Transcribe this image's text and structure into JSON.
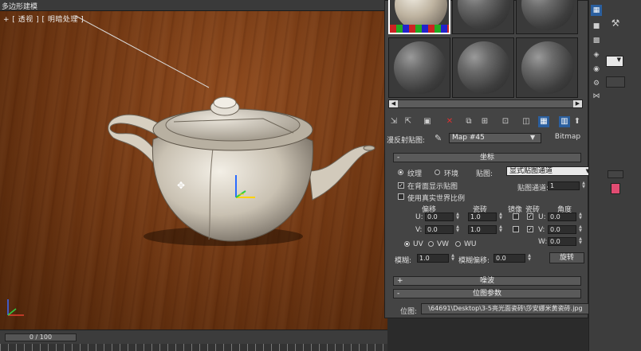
{
  "viewport": {
    "title": "多边形建模",
    "label": "+ [ 透视 ] [ 明暗处理 ]"
  },
  "timeline": {
    "frame": "0 / 100"
  },
  "material_editor": {
    "map_label": "漫反射贴图:",
    "map_name": "Map #45",
    "map_type": "Bitmap",
    "coords": {
      "header": "坐标",
      "texture": "纹理",
      "environ": "环境",
      "mapping_label": "贴图:",
      "mapping_value": "显式贴图通道",
      "show_on_back": "在背面显示贴图",
      "real_world": "使用真实世界比例",
      "map_channel_label": "贴图通道:",
      "map_channel_value": "1",
      "offset": "偏移",
      "tiling": "瓷砖",
      "mirror": "镜像",
      "tile": "瓷砖",
      "angle": "角度",
      "u": "U:",
      "v": "V:",
      "w": "W:",
      "u_offset": "0.0",
      "v_offset": "0.0",
      "u_tiling": "1.0",
      "v_tiling": "1.0",
      "u_angle": "0.0",
      "v_angle": "0.0",
      "w_angle": "0.0",
      "uv": "UV",
      "vw": "VW",
      "wu": "WU",
      "blur_label": "模糊:",
      "blur_value": "1.0",
      "blur_offset_label": "模糊偏移:",
      "blur_offset_value": "0.0",
      "rotate": "旋转"
    },
    "noise": {
      "header": "噪波"
    },
    "bitmap": {
      "header": "位图参数",
      "path_label": "位图:",
      "path_value": "\\64691\\Desktop\\3-5亮光面瓷砖\\莎安娜米黄瓷砖.jpg"
    }
  },
  "colors": {
    "accent": "#2b5f9e",
    "swatch": "#e24c72"
  }
}
